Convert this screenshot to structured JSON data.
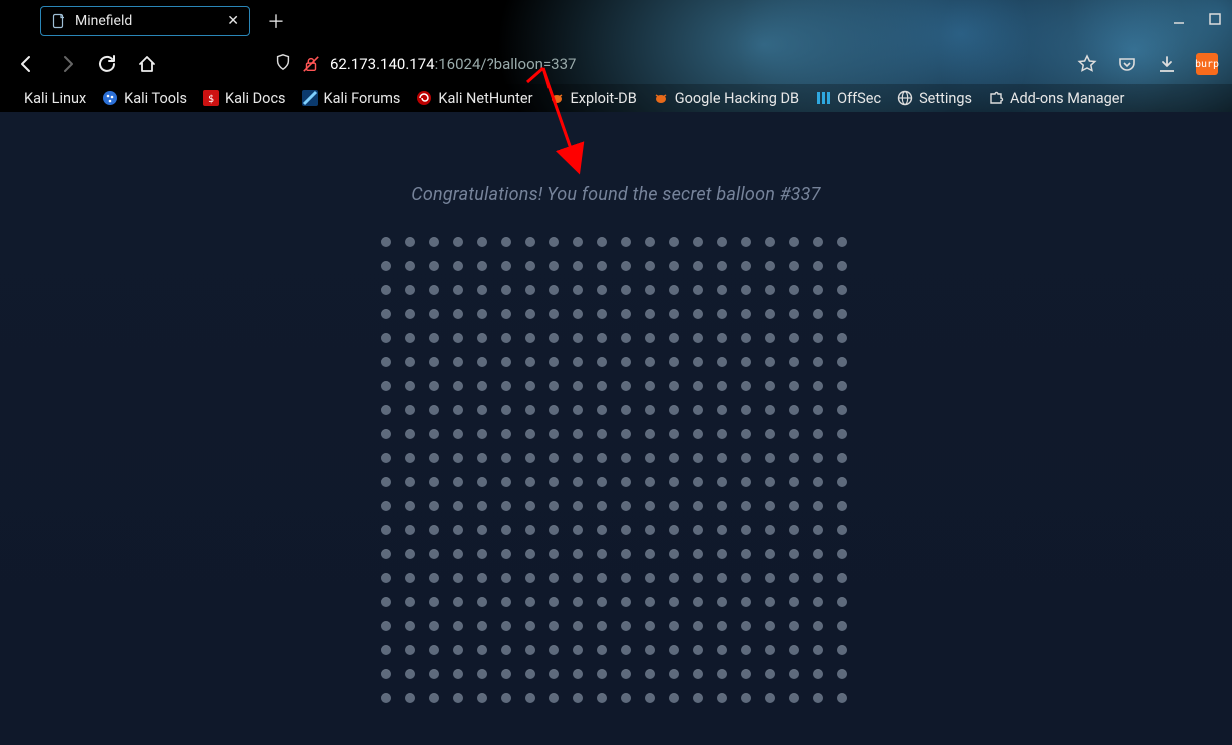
{
  "tab": {
    "title": "Minefield"
  },
  "address": {
    "host": "62.173.140.174",
    "rest": ":16024/?balloon=337"
  },
  "bookmarks": [
    {
      "label": "Kali Linux",
      "icon": "none"
    },
    {
      "label": "Kali Tools",
      "icon": "blue-round"
    },
    {
      "label": "Kali Docs",
      "icon": "red-square"
    },
    {
      "label": "Kali Forums",
      "icon": "blue-diag"
    },
    {
      "label": "Kali NetHunter",
      "icon": "red-swirl"
    },
    {
      "label": "Exploit-DB",
      "icon": "orange-bug"
    },
    {
      "label": "Google Hacking DB",
      "icon": "orange-bug"
    },
    {
      "label": "OffSec",
      "icon": "blue-stripes"
    },
    {
      "label": "Settings",
      "icon": "globe"
    },
    {
      "label": "Add-ons Manager",
      "icon": "puzzle"
    }
  ],
  "grid": {
    "cols": 20,
    "rows": 20
  },
  "page": {
    "message": "Congratulations! You found the secret balloon #337"
  },
  "ext": {
    "badge": "burp"
  }
}
